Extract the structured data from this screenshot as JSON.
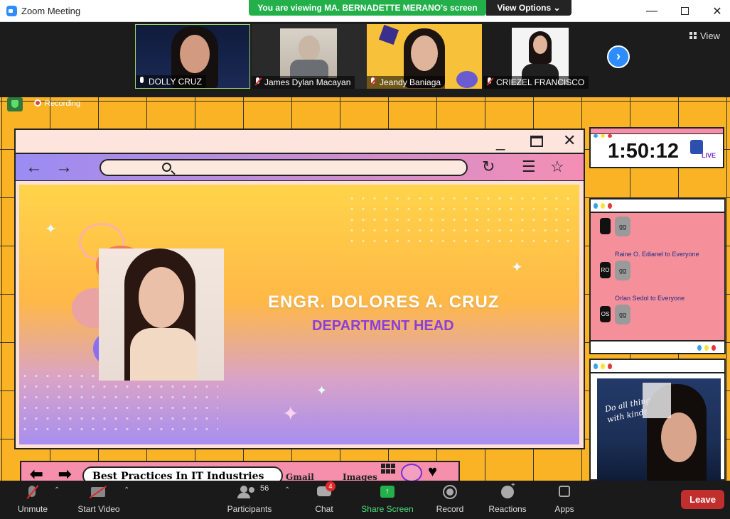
{
  "window": {
    "title": "Zoom Meeting",
    "viewing_banner": "You are viewing MA. BERNADETTE MERANO's screen",
    "view_options_label": "View Options"
  },
  "participants_strip": {
    "tiles": [
      {
        "name": "DOLLY CRUZ",
        "mic": "speaking"
      },
      {
        "name": "James Dylan Macayan",
        "mic": "muted"
      },
      {
        "name": "Jeandy Baniaga",
        "mic": "muted"
      },
      {
        "name": "CRIEZEL FRANCISCO",
        "mic": "muted"
      }
    ],
    "view_label": "View"
  },
  "recording_label": "Recording",
  "shared_slide": {
    "headline": "ENGR. DOLORES A. CRUZ",
    "subline": "DEPARTMENT HEAD",
    "bottom_search": "Best Practices In IT Industries",
    "bottom_link_1": "Gmail",
    "bottom_link_2": "Images",
    "timer": "1:50:12",
    "live_label": "LIVE",
    "chat": [
      {
        "sender": "",
        "initials": "",
        "text": "gg"
      },
      {
        "sender": "Raine O. Edianel to Everyone",
        "initials": "RO",
        "text": "gg"
      },
      {
        "sender": "Orlan Sedol to Everyone",
        "initials": "OS",
        "text": "gg"
      }
    ],
    "cam_script": "Do all things\nwith kindness"
  },
  "toolbar": {
    "unmute": "Unmute",
    "start_video": "Start Video",
    "participants": "Participants",
    "participants_count": "56",
    "chat": "Chat",
    "chat_badge": "4",
    "share_screen": "Share Screen",
    "record": "Record",
    "reactions": "Reactions",
    "apps": "Apps",
    "leave": "Leave"
  },
  "colors": {
    "share_green": "#23b04b",
    "leave_red": "#c12e2e",
    "zoom_blue": "#2d8cff",
    "slide_orange": "#f9b325"
  }
}
